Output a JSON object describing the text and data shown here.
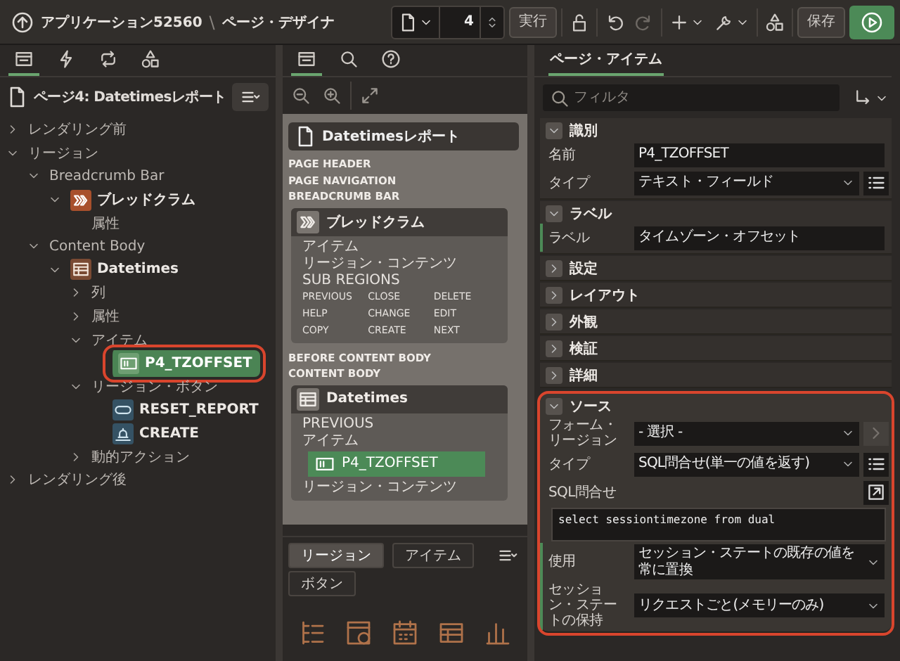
{
  "header": {
    "app": "アプリケーション52560",
    "separator": "\\",
    "title": "ページ・デザイナ"
  },
  "toolbar": {
    "page_number": "4",
    "run": "実行",
    "save": "保存"
  },
  "left_panel": {
    "tabs": [
      {
        "kind": "layout",
        "selected": true
      },
      {
        "kind": "bolt",
        "selected": false
      },
      {
        "kind": "loop",
        "selected": false
      },
      {
        "kind": "shapes",
        "selected": false
      }
    ],
    "page_title": "ページ4: Datetimesレポート",
    "tree": [
      {
        "label": "レンダリング前",
        "expanded": false,
        "selected": false,
        "highlighted": false
      },
      {
        "label": "リージョン",
        "expanded": true,
        "selected": false,
        "highlighted": false,
        "children": [
          {
            "label": "Breadcrumb Bar",
            "expanded": true,
            "selected": false,
            "highlighted": false,
            "children": [
              {
                "label": "ブレッドクラム",
                "kind": "breadcrumb",
                "expanded": true,
                "selected": false,
                "highlighted": false,
                "children": [
                  {
                    "label": "属性",
                    "selected": false,
                    "highlighted": false
                  }
                ]
              }
            ]
          },
          {
            "label": "Content Body",
            "expanded": true,
            "selected": false,
            "highlighted": false,
            "children": [
              {
                "label": "Datetimes",
                "kind": "report",
                "expanded": true,
                "selected": false,
                "highlighted": false,
                "children": [
                  {
                    "label": "列",
                    "expanded": false,
                    "selected": false,
                    "highlighted": false
                  },
                  {
                    "label": "属性",
                    "expanded": false,
                    "selected": false,
                    "highlighted": false
                  },
                  {
                    "label": "アイテム",
                    "expanded": true,
                    "selected": false,
                    "highlighted": false,
                    "children": [
                      {
                        "label": "P4_TZOFFSET",
                        "kind": "item",
                        "selected": true,
                        "highlighted": true
                      }
                    ]
                  },
                  {
                    "label": "リージョン・ボタン",
                    "expanded": true,
                    "selected": false,
                    "highlighted": false,
                    "children": [
                      {
                        "label": "RESET_REPORT",
                        "kind": "text-button",
                        "selected": false,
                        "highlighted": false
                      },
                      {
                        "label": "CREATE",
                        "kind": "icon-button",
                        "selected": false,
                        "highlighted": false
                      }
                    ]
                  },
                  {
                    "label": "動的アクション",
                    "expanded": false,
                    "selected": false,
                    "highlighted": false
                  }
                ]
              }
            ]
          }
        ]
      },
      {
        "label": "レンダリング後",
        "expanded": false,
        "selected": false,
        "highlighted": false
      }
    ]
  },
  "middle_panel": {
    "tabs": [
      {
        "kind": "layout",
        "selected": true
      },
      {
        "kind": "search",
        "selected": false
      },
      {
        "kind": "help",
        "selected": false
      }
    ],
    "layout": {
      "page_title": "Datetimesレポート",
      "entries": [
        {
          "kind": "label",
          "text": "PAGE HEADER"
        },
        {
          "kind": "label",
          "text": "PAGE NAVIGATION"
        },
        {
          "kind": "label",
          "text": "BREADCRUMB BAR"
        },
        {
          "kind": "region",
          "title": "ブレッドクラム",
          "rows": [
            {
              "kind": "label",
              "text": "アイテム"
            },
            {
              "kind": "label",
              "text": "リージョン・コンテンツ"
            },
            {
              "kind": "label",
              "text": "SUB REGIONS"
            },
            {
              "kind": "grid",
              "cells": [
                "PREVIOUS",
                "CLOSE",
                "DELETE",
                "HELP",
                "CHANGE",
                "EDIT",
                "COPY",
                "CREATE",
                "NEXT"
              ]
            }
          ]
        },
        {
          "kind": "label",
          "text": "BEFORE CONTENT BODY"
        },
        {
          "kind": "label",
          "text": "CONTENT BODY"
        },
        {
          "kind": "region",
          "title": "Datetimes",
          "rows": [
            {
              "kind": "label",
              "text": "PREVIOUS"
            },
            {
              "kind": "label",
              "text": "アイテム"
            },
            {
              "kind": "item",
              "text": "P4_TZOFFSET",
              "selected": true
            },
            {
              "kind": "label",
              "text": "リージョン・コンテンツ"
            }
          ]
        }
      ]
    },
    "gallery": {
      "tabs": [
        {
          "label": "リージョン",
          "selected": true
        },
        {
          "label": "アイテム",
          "selected": false
        },
        {
          "label": "ボタン",
          "selected": false
        }
      ]
    }
  },
  "property_editor": {
    "tabs": [
      {
        "label": "ページ・アイテム",
        "selected": true
      }
    ],
    "filter": {
      "placeholder": "フィルタ"
    },
    "groups": [
      {
        "title": "識別",
        "expanded": true,
        "highlighted": false,
        "properties": [
          {
            "label": "名前",
            "kind": "text",
            "value": "P4_TZOFFSET",
            "changed": false
          },
          {
            "label": "タイプ",
            "kind": "select",
            "value": "テキスト・フィールド",
            "changed": false,
            "button": {
              "kind": "list",
              "disabled": false
            }
          }
        ]
      },
      {
        "title": "ラベル",
        "expanded": true,
        "highlighted": false,
        "properties": [
          {
            "label": "ラベル",
            "kind": "text",
            "value": "タイムゾーン・オフセット",
            "changed": true
          }
        ]
      },
      {
        "title": "設定",
        "expanded": false,
        "highlighted": false
      },
      {
        "title": "レイアウト",
        "expanded": false,
        "highlighted": false
      },
      {
        "title": "外観",
        "expanded": false,
        "highlighted": false
      },
      {
        "title": "検証",
        "expanded": false,
        "highlighted": false
      },
      {
        "title": "詳細",
        "expanded": false,
        "highlighted": false
      },
      {
        "title": "ソース",
        "expanded": true,
        "highlighted": true,
        "properties": [
          {
            "label": "フォーム・リージョン",
            "kind": "select",
            "value": "- 選択 -",
            "changed": false,
            "button": {
              "kind": "arrow",
              "disabled": true
            }
          },
          {
            "label": "タイプ",
            "kind": "select",
            "value": "SQL問合せ(単一の値を返す)",
            "changed": false,
            "button": {
              "kind": "list",
              "disabled": false
            }
          },
          {
            "label": "SQL問合せ",
            "kind": "code",
            "value": "select sessiontimezone from dual",
            "changed": false,
            "button": {
              "kind": "popout",
              "disabled": false
            }
          },
          {
            "label": "使用",
            "kind": "select",
            "value": "セッション・ステートの既存の値を常に置換",
            "changed": true
          },
          {
            "label": "セッション・ステートの保持",
            "kind": "select",
            "value": "リクエストごと(メモリーのみ)",
            "changed": true
          }
        ]
      }
    ]
  }
}
